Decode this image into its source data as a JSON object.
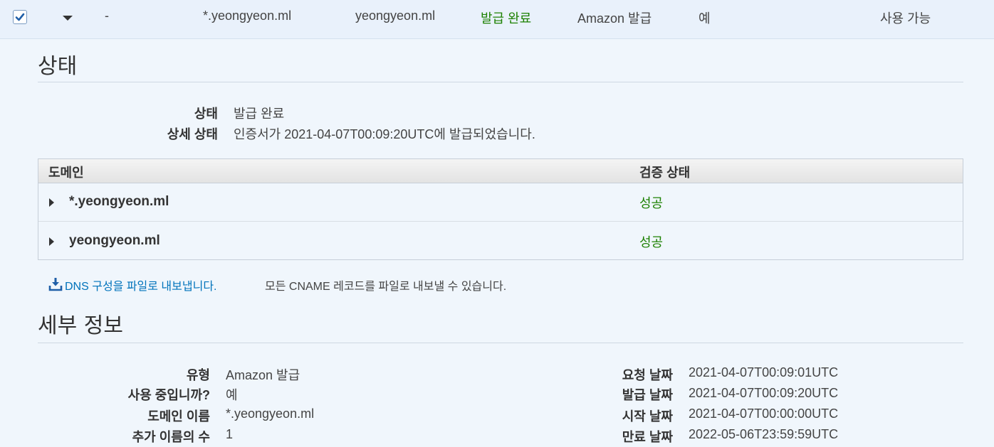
{
  "row": {
    "checked": true,
    "dash": "-",
    "domain_name": "*.yeongyeon.ml",
    "extra_name": "yeongyeon.ml",
    "status": "발급 완료",
    "type": "Amazon 발급",
    "in_use": "예",
    "renewal": "사용 가능"
  },
  "status_section": {
    "title": "상태",
    "status_label": "상태",
    "status_value": "발급 완료",
    "detail_label": "상세 상태",
    "detail_value": "인증서가 2021-04-07T00:09:20UTC에 발급되었습니다."
  },
  "domain_table": {
    "col_domain": "도메인",
    "col_validation": "검증 상태",
    "rows": [
      {
        "domain": "*.yeongyeon.ml",
        "validation": "성공"
      },
      {
        "domain": "yeongyeon.ml",
        "validation": "성공"
      }
    ]
  },
  "export": {
    "link_label": "DNS 구성을 파일로 내보냅니다.",
    "note": "모든 CNAME 레코드를 파일로 내보낼 수 있습니다."
  },
  "details": {
    "title": "세부 정보",
    "left": [
      {
        "label": "유형",
        "value": "Amazon 발급"
      },
      {
        "label": "사용 중입니까?",
        "value": "예"
      },
      {
        "label": "도메인 이름",
        "value": "*.yeongyeon.ml"
      },
      {
        "label": "추가 이름의 수",
        "value": "1"
      }
    ],
    "right": [
      {
        "label": "요청 날짜",
        "value": "2021-04-07T00:09:01UTC"
      },
      {
        "label": "발급 날짜",
        "value": "2021-04-07T00:09:20UTC"
      },
      {
        "label": "시작 날짜",
        "value": "2021-04-07T00:00:00UTC"
      },
      {
        "label": "만료 날짜",
        "value": "2022-05-06T23:59:59UTC"
      }
    ]
  },
  "colors": {
    "success": "#1d8102",
    "link": "#0073bb",
    "background": "#f0f6fc",
    "selected_row": "#e9f1fb"
  }
}
